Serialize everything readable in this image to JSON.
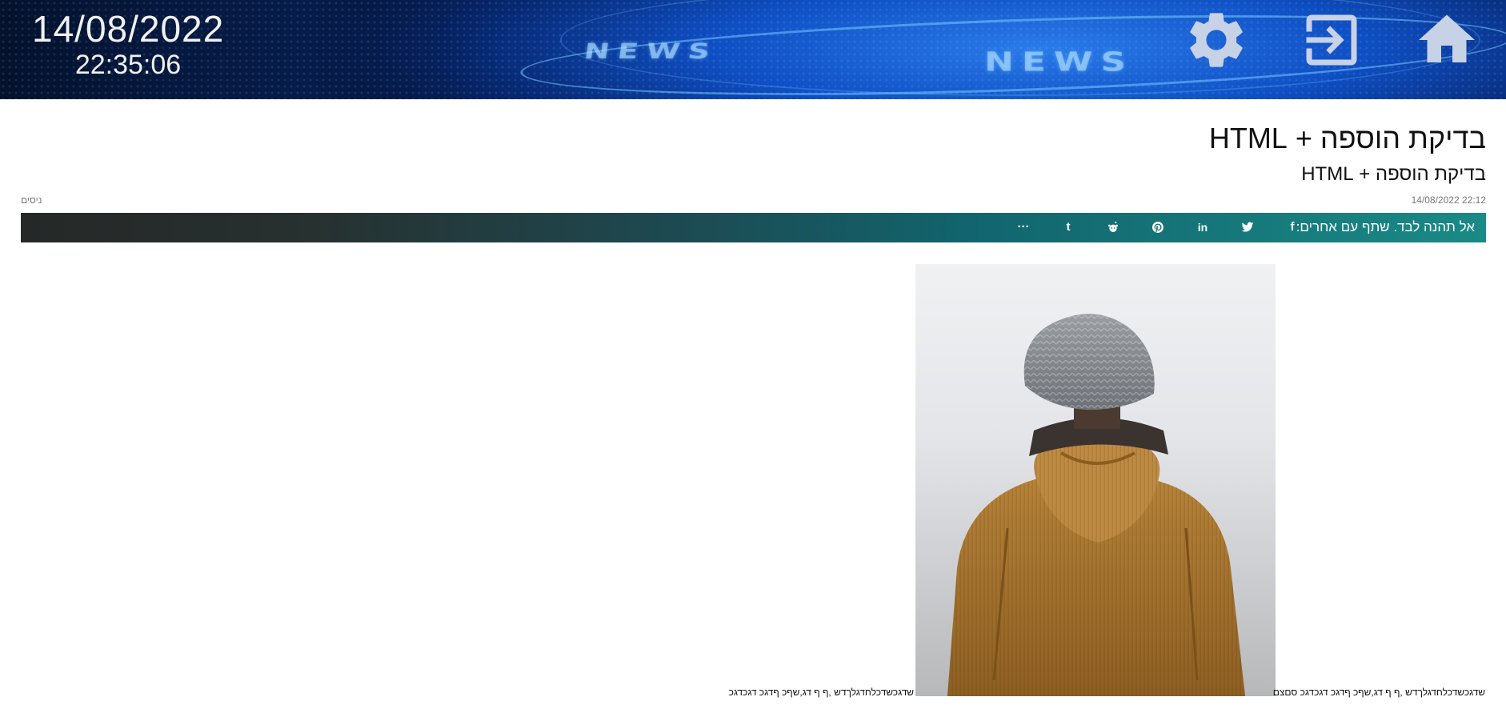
{
  "header": {
    "date": "14/08/2022",
    "time": "22:35:06",
    "banner_words": [
      "NEWS",
      "NEWS"
    ],
    "icons": {
      "settings": "gear-icon",
      "login": "login-icon",
      "home": "home-icon"
    }
  },
  "article": {
    "title": "בדיקת הוספה + HTML",
    "subtitle": "בדיקת הוספה + HTML",
    "date": "22:12 14/08/2022",
    "category": "ניסים",
    "share": {
      "label": "אל תהנה לבד. שתף עם אחרים:",
      "icons": [
        "facebook-icon",
        "twitter-icon",
        "linkedin-icon",
        "pinterest-icon",
        "reddit-icon",
        "tumblr-icon",
        "more-icon"
      ],
      "glyphs": [
        "f",
        "t",
        "in",
        "p",
        "r",
        "t",
        "···"
      ]
    },
    "body_text_1": "שדגכשדכלחדגלךדש ,ף ף דג,שףכ ףדגכ דגכדגכ סםצם",
    "body_text_2": "שדגכשדכלחדגלךדש ,ף ף דג,שףכ ףדגכ דגכדגכ"
  },
  "colors": {
    "banner_blue": "#0f4fc4",
    "share_bar_teal": "#1a8a86",
    "share_bar_dark": "#252827",
    "header_icon": "#c8d2e6"
  }
}
